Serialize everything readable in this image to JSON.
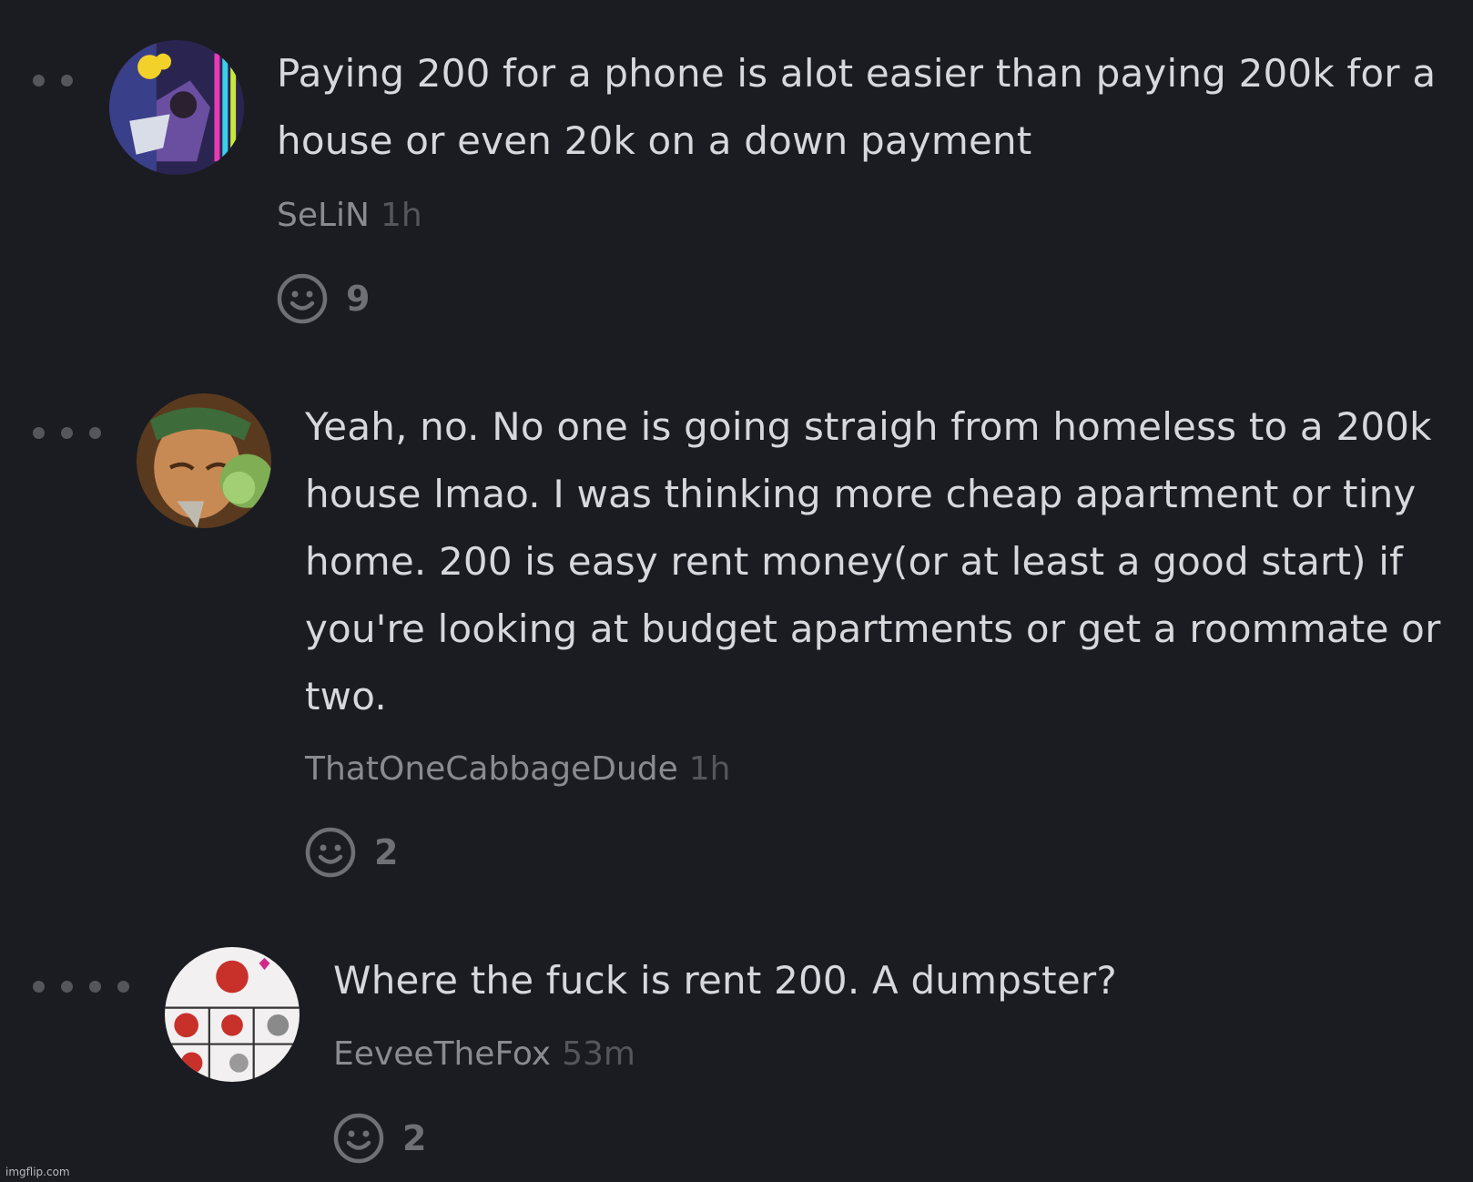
{
  "comments": [
    {
      "text": "Paying 200 for a phone is alot easier than paying 200k for a house or even 20k on a down payment",
      "author": "SeLiN",
      "time": "1h",
      "reaction_icon": "smiley-icon",
      "reaction_count": "9",
      "thread_depth": 2
    },
    {
      "text": "Yeah, no. No one is going straigh from homeless to a 200k house lmao. I was thinking more cheap apartment or tiny home. 200 is easy rent money(or at least a good start) if you're looking at budget apartments or get a roommate or two.",
      "author": "ThatOneCabbageDude",
      "time": "1h",
      "reaction_icon": "smiley-icon",
      "reaction_count": "2",
      "thread_depth": 3
    },
    {
      "text": "Where the fuck is rent 200. A dumpster?",
      "author": "EeveeTheFox",
      "time": "53m",
      "reaction_icon": "smiley-icon",
      "reaction_count": "2",
      "thread_depth": 4
    }
  ],
  "watermark": "imgflip.com",
  "colors": {
    "background": "#1b1c21",
    "text": "#d7d8dc",
    "author": "#8a8b91",
    "time": "#55565b",
    "icon": "#6f7076"
  }
}
